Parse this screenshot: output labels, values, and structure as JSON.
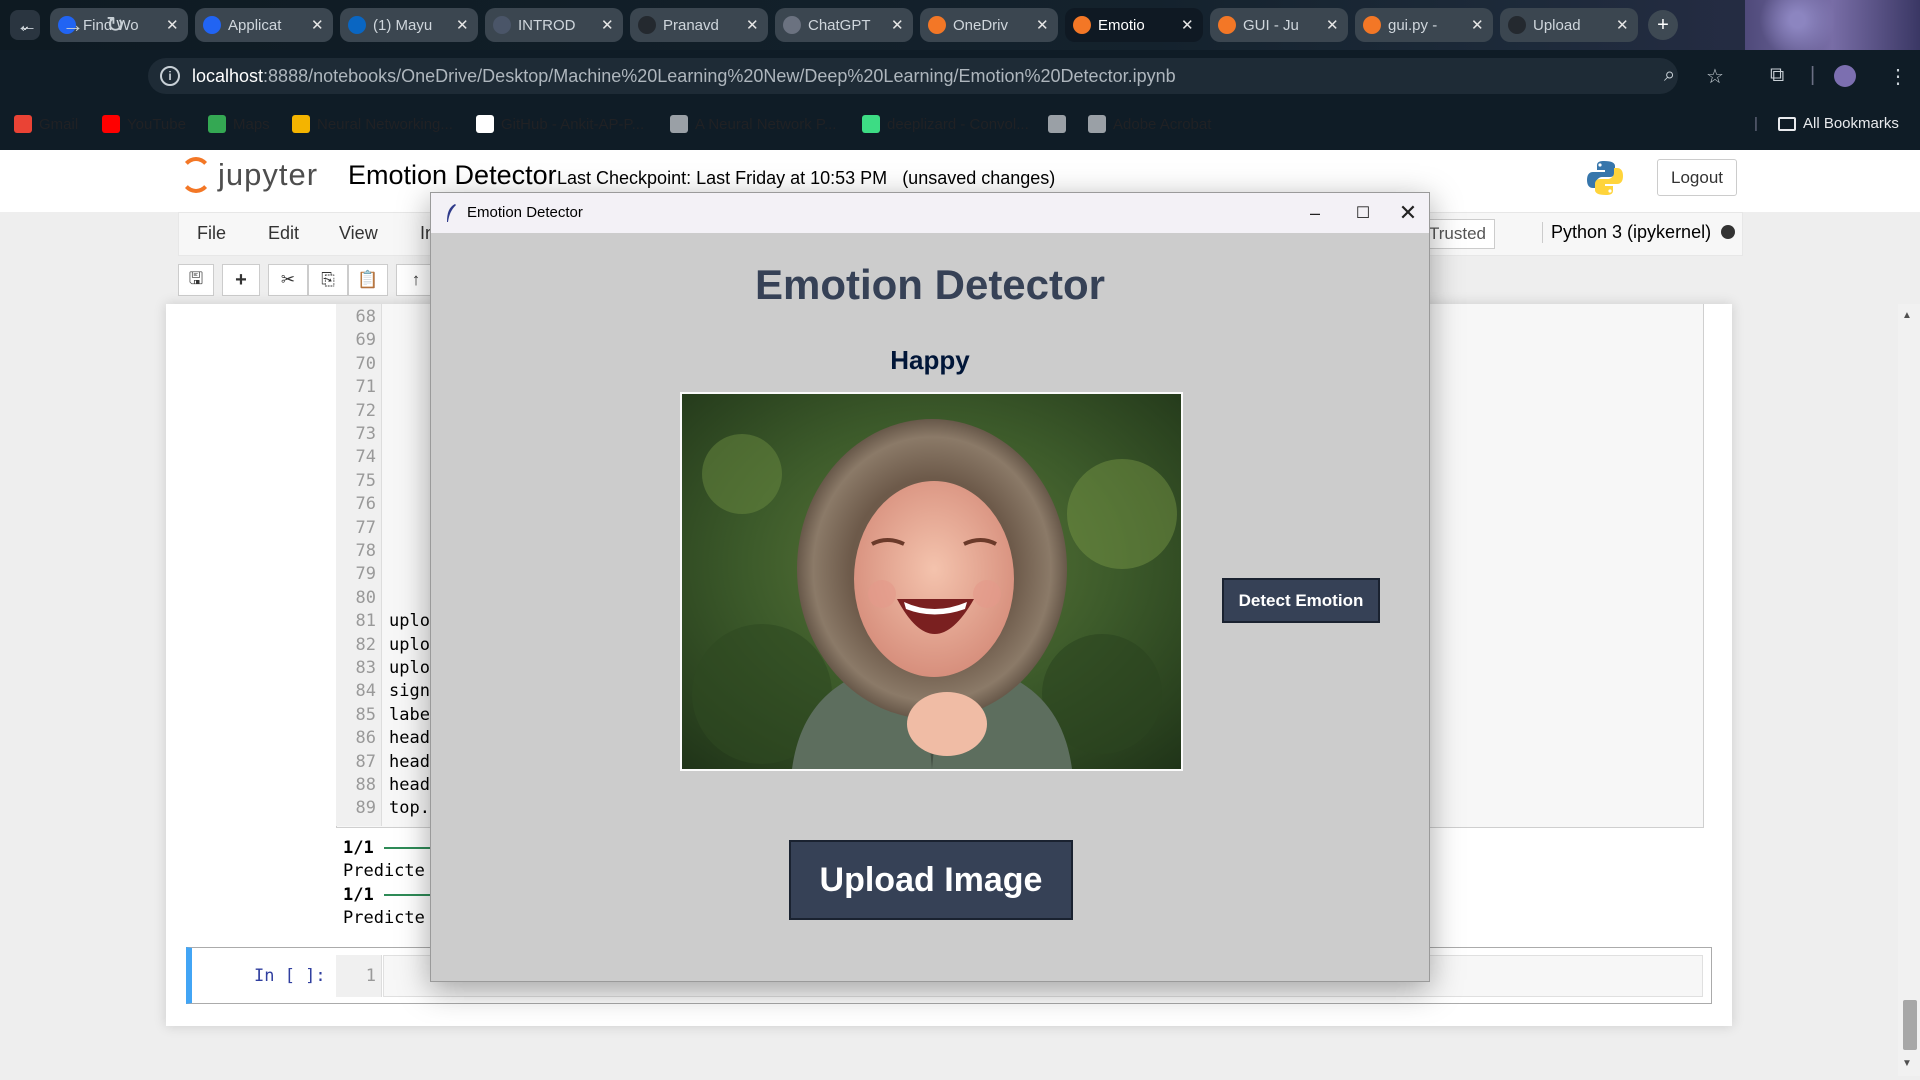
{
  "browser": {
    "tabs": [
      {
        "label": "Find Wo",
        "icon": "indeed-icon",
        "color": "#2164f3"
      },
      {
        "label": "Applicat",
        "icon": "indeed-icon",
        "color": "#2164f3"
      },
      {
        "label": "(1) Mayu",
        "icon": "linkedin-icon",
        "color": "#0a66c2"
      },
      {
        "label": "INTROD",
        "icon": "document-icon",
        "color": "#4a5568"
      },
      {
        "label": "Pranavd",
        "icon": "github-icon",
        "color": "#24292f"
      },
      {
        "label": "ChatGPT",
        "icon": "chatgpt-icon",
        "color": "#6b7280"
      },
      {
        "label": "OneDriv",
        "icon": "jupyter-icon",
        "color": "#f37726"
      },
      {
        "label": "Emotio",
        "icon": "hourglass-icon",
        "color": "#f37726"
      },
      {
        "label": "GUI - Ju",
        "icon": "jupyter-book-icon",
        "color": "#f37726"
      },
      {
        "label": "gui.py -",
        "icon": "file-icon",
        "color": "#f37726"
      },
      {
        "label": "Upload",
        "icon": "github-icon",
        "color": "#24292f"
      }
    ],
    "active_tab_index": 7,
    "address": {
      "host": "localhost",
      "path": ":8888/notebooks/OneDrive/Desktop/Machine%20Learning%20New/Deep%20Learning/Emotion%20Detector.ipynb"
    },
    "bookmarks": [
      {
        "label": "Gmail",
        "icon": "gmail-icon",
        "color": "#ea4335"
      },
      {
        "label": "YouTube",
        "icon": "youtube-icon",
        "color": "#ff0000"
      },
      {
        "label": "Maps",
        "icon": "maps-icon",
        "color": "#34a853"
      },
      {
        "label": "Neural Networking...",
        "icon": "bookmark-icon",
        "color": "#f4b400"
      },
      {
        "label": "GitHub - Ankit-AP-P...",
        "icon": "github-icon",
        "color": "#ffffff"
      },
      {
        "label": "A Neural Network P...",
        "icon": "playground-icon",
        "color": "#9aa0a6"
      },
      {
        "label": "deeplizard - Convol...",
        "icon": "lizard-icon",
        "color": "#3ddc84"
      },
      {
        "label": "",
        "icon": "globe-icon",
        "color": "#9aa0a6"
      },
      {
        "label": "Adobe Acrobat",
        "icon": "globe-icon",
        "color": "#9aa0a6"
      }
    ],
    "all_bookmarks": "All Bookmarks"
  },
  "jupyter": {
    "logo_text": "jupyter",
    "notebook_title": "Emotion Detector",
    "checkpoint": "Last Checkpoint: Last Friday at 10:53 PM",
    "unsaved": "(unsaved changes)",
    "logout": "Logout",
    "menu": [
      "File",
      "Edit",
      "View",
      "In"
    ],
    "trusted": "Trusted",
    "kernel": "Python 3 (ipykernel)",
    "line_numbers": [
      "68",
      "69",
      "70",
      "71",
      "72",
      "73",
      "74",
      "75",
      "76",
      "77",
      "78",
      "79",
      "80",
      "81",
      "82",
      "83",
      "84",
      "85",
      "86",
      "87",
      "88",
      "89"
    ],
    "code_lines": {
      "81": "uplo",
      "82": "uplo",
      "83": "uplo",
      "84": "sign",
      "85": "labe",
      "86": "head",
      "87": "head",
      "88": "head",
      "89": "top."
    },
    "outputs": [
      {
        "progress": "1/1",
        "text": "Predicte"
      },
      {
        "progress": "1/1",
        "text": "Predicte"
      }
    ],
    "input_prompt": "In [ ]:",
    "input_line": "1"
  },
  "app": {
    "window_title": "Emotion Detector",
    "heading": "Emotion Detector",
    "result": "Happy",
    "detect_button": "Detect Emotion",
    "upload_button": "Upload Image",
    "colors": {
      "bg": "#cccccc",
      "button": "#364156",
      "heading": "#364156",
      "result": "#011638"
    }
  }
}
